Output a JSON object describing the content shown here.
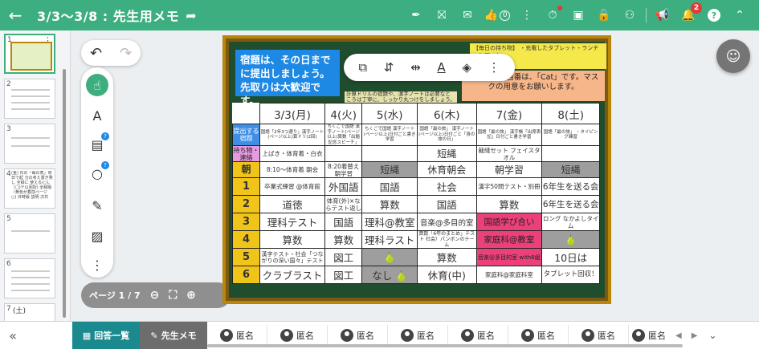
{
  "header": {
    "back_icon": "arrow-left-icon",
    "title": "3/3〜3/8 : 先生用メモ",
    "share_icon": "share-arrow-icon",
    "thumbs_count": "0",
    "notification_count": "2",
    "accent_color": "#3dae7f"
  },
  "toolbar": {
    "page_indicator": "ページ 1 / 7"
  },
  "thumbnails": [
    {
      "num": "1"
    },
    {
      "num": "2"
    },
    {
      "num": "3"
    },
    {
      "num": "4",
      "text": "(金) 日の「毎の表」常日で起 分の考え書き発し 全録に 使える(○)。（□)テ以回授) 全録版（黄色が着前ページ ○) 日時版 説明 次共"
    },
    {
      "num": "5"
    },
    {
      "num": "6"
    },
    {
      "num": "7",
      "text": "(土)"
    }
  ],
  "board": {
    "note_blue": "宿題は、その日までに提出しましょう。先取りは大歓迎です。",
    "note_yellow": "【毎日の持ち物】 ・充電したタブレット・ランチョンマット",
    "note_orange": "今週の給食当番は、「Cat」です。マスクの用意をお願いします。",
    "note_small": "計算ドリルの宿題や、漢字ノートは必要なところは丁寧に、しっかり丸つけをしましょう。"
  },
  "schedule": {
    "days": [
      "3/3(月)",
      "4(火)",
      "5(水)",
      "6(木)",
      "7(金)",
      "8(土)"
    ],
    "teishutsu_label": "提出する宿題",
    "teishutsu": [
      "国語「2年3つ選り」漢字ノート(ページ以上)算ドリ(2回)",
      "ちくごで国語 漢字ノート(ページ以上)算数「出題記念スピーチ」",
      "ちくごで国語 漢字ノート(ページ以上)日付ごと書き学習",
      "国語「最の旅」 漢字ノート(ページ以上)日付ごと「身の旅の日」",
      "国語「最の旅」 漢字帳「出席表記」日付ごと書き学習",
      "国語「最の旅」 ・タイピング練習"
    ],
    "mochimono_label": "持ち物・連絡",
    "mochimono": [
      "上ばき・体育着・白衣",
      "",
      "",
      "短縄",
      "裁縫セット フェイスタオル",
      ""
    ],
    "asa_label": "朝",
    "asa": [
      "8:10〜体育着 朝会",
      "8:20着替え 朝学習",
      "短縄",
      "休育朝会",
      "朝学習",
      "短縄"
    ],
    "periods": [
      {
        "label": "1",
        "cells": [
          "卒業式練習 @体育館",
          "外国語",
          "国語",
          "社会",
          "漢字50問テスト・別冊",
          "6年生を送る会"
        ]
      },
      {
        "label": "2",
        "cells": [
          "道徳",
          "体育(外)×ならテスト返し",
          "算数",
          "国語",
          "算数",
          "6年生を送る会"
        ]
      },
      {
        "label": "3",
        "cells": [
          "理科テスト",
          "国語",
          "理科@教室",
          "音楽@多目的室",
          "国語学び合い",
          "ロング なかよしタイム"
        ]
      },
      {
        "label": "4",
        "cells": [
          "算数",
          "算数",
          "理科ラスト",
          "算数「6年のまとめ」テスト 社会）パンボンのテーム",
          "家庭科@教室",
          ""
        ]
      },
      {
        "label": "5",
        "cells": [
          "漢字テスト・社会「つながりの深い国々」テスト",
          "図工",
          "",
          "算数",
          "音楽@多目的室 with6組",
          "10日は"
        ]
      },
      {
        "label": "6",
        "cells": [
          "クラブラスト",
          "図工",
          "なし",
          "休育(中)",
          "家庭科@家庭科室",
          "タブレット回収！"
        ]
      }
    ]
  },
  "bottom": {
    "collapse_icon": "double-chevron-left-icon",
    "answers_tab": "回答一覧",
    "memo_tab": "先生メモ",
    "student_name": "匿名",
    "students_count": 8
  }
}
